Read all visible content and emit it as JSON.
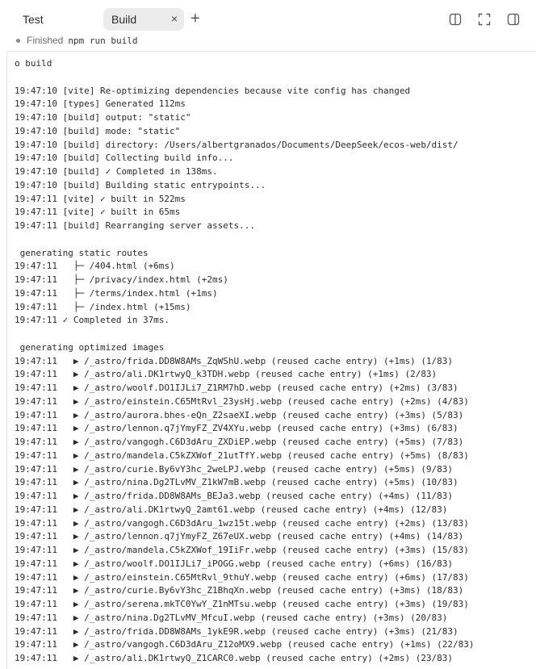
{
  "tabs": [
    {
      "label": "Test"
    },
    {
      "label": "Build",
      "close": "×"
    }
  ],
  "new_tab_label": "+",
  "toolbar_icons": [
    "split-view-icon",
    "fullscreen-icon",
    "sidebar-icon"
  ],
  "status": {
    "text": "Finished",
    "command": "npm run build"
  },
  "log_lines": [
    "o build",
    "",
    "19:47:10 [vite] Re-optimizing dependencies because vite config has changed",
    "19:47:10 [types] Generated 112ms",
    "19:47:10 [build] output: \"static\"",
    "19:47:10 [build] mode: \"static\"",
    "19:47:10 [build] directory: /Users/albertgranados/Documents/DeepSeek/ecos-web/dist/",
    "19:47:10 [build] Collecting build info...",
    "19:47:10 [build] ✓ Completed in 138ms.",
    "19:47:10 [build] Building static entrypoints...",
    "19:47:11 [vite] ✓ built in 522ms",
    "19:47:11 [vite] ✓ built in 65ms",
    "19:47:11 [build] Rearranging server assets...",
    "",
    " generating static routes",
    "19:47:11   ├─ /404.html (+6ms)",
    "19:47:11   ├─ /privacy/index.html (+2ms)",
    "19:47:11   ├─ /terms/index.html (+1ms)",
    "19:47:11   ├─ /index.html (+15ms)",
    "19:47:11 ✓ Completed in 37ms.",
    "",
    " generating optimized images",
    "19:47:11   ▶ /_astro/frida.DD8W8AMs_ZqWShU.webp (reused cache entry) (+1ms) (1/83)",
    "19:47:11   ▶ /_astro/ali.DK1rtwyQ_k3TDH.webp (reused cache entry) (+1ms) (2/83)",
    "19:47:11   ▶ /_astro/woolf.DO1IJLi7_Z1RM7hD.webp (reused cache entry) (+2ms) (3/83)",
    "19:47:11   ▶ /_astro/einstein.C65MtRvl_23ysHj.webp (reused cache entry) (+2ms) (4/83)",
    "19:47:11   ▶ /_astro/aurora.bhes-eQn_Z2saeXI.webp (reused cache entry) (+3ms) (5/83)",
    "19:47:11   ▶ /_astro/lennon.q7jYmyFZ_ZV4XYu.webp (reused cache entry) (+3ms) (6/83)",
    "19:47:11   ▶ /_astro/vangogh.C6D3dAru_ZXDiEP.webp (reused cache entry) (+5ms) (7/83)",
    "19:47:11   ▶ /_astro/mandela.C5kZXWof_21utTfY.webp (reused cache entry) (+5ms) (8/83)",
    "19:47:11   ▶ /_astro/curie.By6vY3hc_2weLPJ.webp (reused cache entry) (+5ms) (9/83)",
    "19:47:11   ▶ /_astro/nina.Dg2TLvMV_Z1kW7mB.webp (reused cache entry) (+5ms) (10/83)",
    "19:47:11   ▶ /_astro/frida.DD8W8AMs_BEJa3.webp (reused cache entry) (+4ms) (11/83)",
    "19:47:11   ▶ /_astro/ali.DK1rtwyQ_2amt61.webp (reused cache entry) (+4ms) (12/83)",
    "19:47:11   ▶ /_astro/vangogh.C6D3dAru_1wz15t.webp (reused cache entry) (+2ms) (13/83)",
    "19:47:11   ▶ /_astro/lennon.q7jYmyFZ_Z67eUX.webp (reused cache entry) (+4ms) (14/83)",
    "19:47:11   ▶ /_astro/mandela.C5kZXWof_19IiFr.webp (reused cache entry) (+3ms) (15/83)",
    "19:47:11   ▶ /_astro/woolf.DO1IJLi7_iPOGG.webp (reused cache entry) (+6ms) (16/83)",
    "19:47:11   ▶ /_astro/einstein.C65MtRvl_9thuY.webp (reused cache entry) (+6ms) (17/83)",
    "19:47:11   ▶ /_astro/curie.By6vY3hc_Z1BhqXn.webp (reused cache entry) (+3ms) (18/83)",
    "19:47:11   ▶ /_astro/serena.mkTC0YwY_Z1nMTsu.webp (reused cache entry) (+3ms) (19/83)",
    "19:47:11   ▶ /_astro/nina.Dg2TLvMV_MfcuI.webp (reused cache entry) (+3ms) (20/83)",
    "19:47:11   ▶ /_astro/frida.DD8W8AMs_1ykE9R.webp (reused cache entry) (+3ms) (21/83)",
    "19:47:11   ▶ /_astro/vangogh.C6D3dAru_Z12oMX9.webp (reused cache entry) (+1ms) (22/83)",
    "19:47:11   ▶ /_astro/ali.DK1rtwyQ_Z1CARC0.webp (reused cache entry) (+2ms) (23/83)"
  ]
}
